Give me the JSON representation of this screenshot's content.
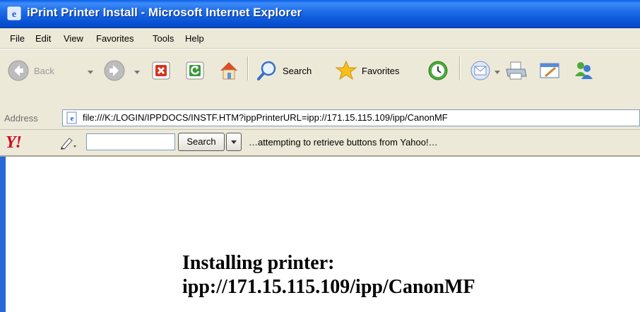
{
  "window": {
    "title": "iPrint Printer Install - Microsoft Internet Explorer"
  },
  "menu": [
    "File",
    "Edit",
    "View",
    "Favorites",
    "Tools",
    "Help"
  ],
  "toolbar": {
    "back_label": "Back",
    "search_label": "Search",
    "favorites_label": "Favorites"
  },
  "address": {
    "label": "Address",
    "url": "file:///K:/LOGIN/IPPDOCS/INSTF.HTM?ippPrinterURL=ipp://171.15.115.109/ipp/CanonMF"
  },
  "yahoo_toolbar": {
    "logo": "Y!",
    "search_button": "Search",
    "status": "…attempting to retrieve buttons from Yahoo!…"
  },
  "content": {
    "heading_line1": "Installing printer:",
    "heading_line2": "ipp://171.15.115.109/ipp/CanonMF"
  },
  "colors": {
    "titlebar": "#0a56d8",
    "chrome": "#ece9d8",
    "yahoo_red": "#d0021b"
  }
}
